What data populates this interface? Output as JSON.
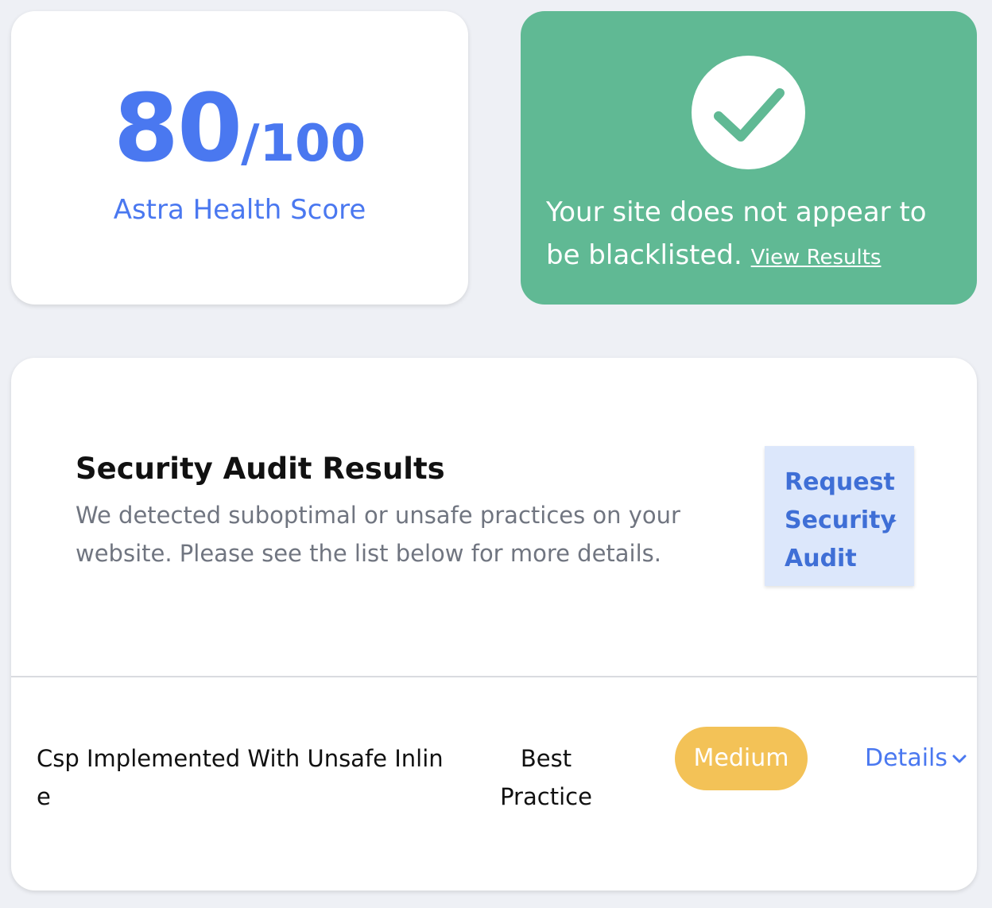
{
  "health": {
    "score": "80",
    "max": "/100",
    "label": "Astra Health Score"
  },
  "blacklist": {
    "message": "Your site does not appear to be blacklisted.",
    "link": "View Results",
    "icon": "checkmark-icon"
  },
  "audit": {
    "title": "Security Audit Results",
    "description": "We detected suboptimal or unsafe practices on your website. Please see the list below for more details.",
    "request_button": "Request Security Audit",
    "issues": [
      {
        "name": "Csp Implemented With Unsafe Inline",
        "category": "Best Practice",
        "severity": "Medium",
        "details": "Details"
      }
    ]
  },
  "colors": {
    "accent": "#4a78f0",
    "success": "#60b994",
    "medium": "#f3c257",
    "request_bg": "#dce7fb"
  }
}
